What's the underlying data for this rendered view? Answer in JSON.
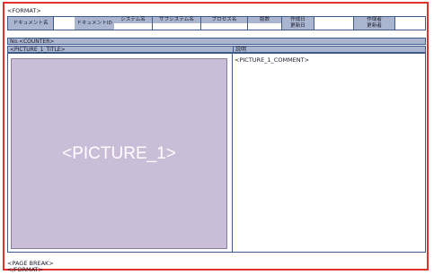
{
  "doc": {
    "format_open": "<FORMAT>",
    "format_close": "</FORMAT>",
    "page_break": "<PAGE BREAK>"
  },
  "header": {
    "document_name": "ドキュメント名",
    "document_id": "ドキュメントID",
    "system_name": "システム名",
    "subsystem_name": "サブシステム名",
    "process_name": "プロセス名",
    "version": "版数",
    "created_date": "作成日",
    "updated_date": "更新日",
    "author": "作成者",
    "updater": "更新者"
  },
  "counter": "No.<COUNTER>",
  "picture_title": "<PICTURE_1_TITLE>",
  "explanation_label": "説明",
  "picture_placeholder": "<PICTURE_1>",
  "picture_comment": "<PICTURE_1_COMMENT>",
  "colors": {
    "frame": "#e0312c",
    "header_fill": "#aab5cf",
    "picture_fill": "#c9bdd8"
  }
}
